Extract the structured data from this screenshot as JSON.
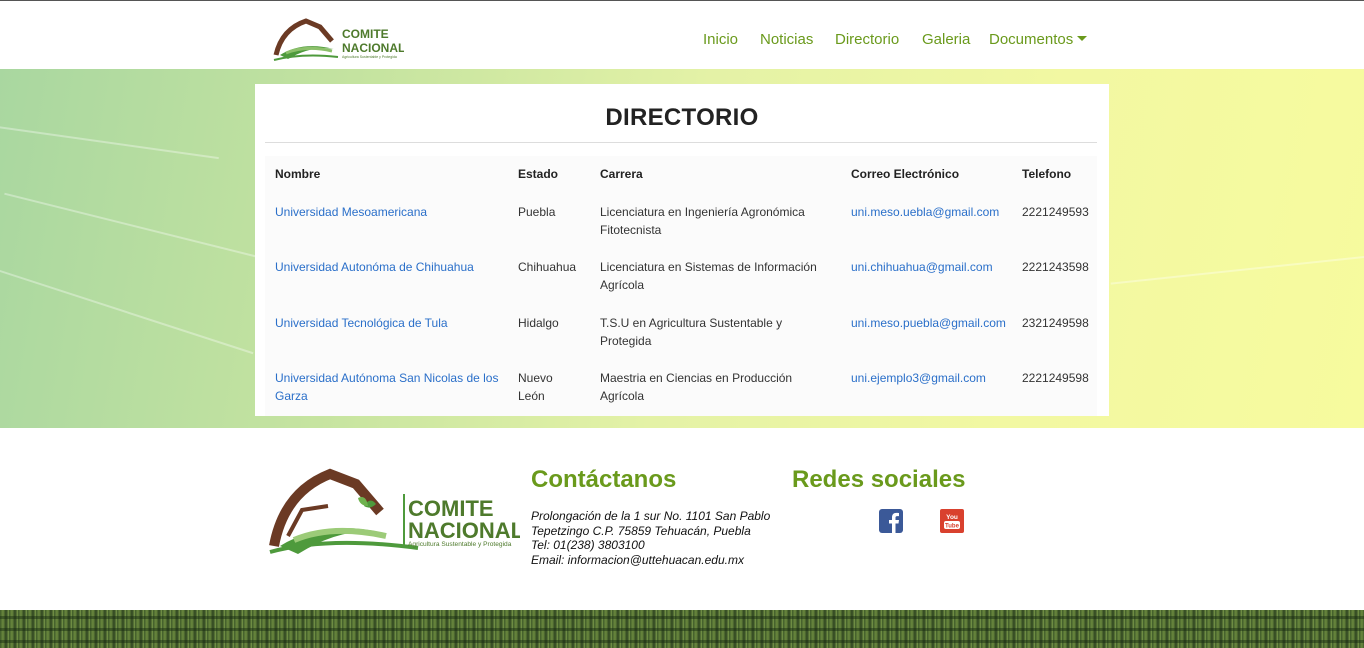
{
  "logo_text": "COMITE NACIONAL",
  "logo_tagline": "Agricultura Sustentable y Protegida",
  "nav": {
    "items": [
      "Inicio",
      "Noticias",
      "Directorio",
      "Galeria",
      "Documentos"
    ]
  },
  "directory": {
    "title": "DIRECTORIO",
    "columns": [
      "Nombre",
      "Estado",
      "Carrera",
      "Correo Electrónico",
      "Telefono"
    ],
    "rows": [
      {
        "nombre": [
          "Universidad Mesoamericana",
          ""
        ],
        "estado": [
          "Puebla",
          ""
        ],
        "carrera": [
          "Licenciatura en Ingeniería Agronómica",
          "Fitotecnista"
        ],
        "correo": "uni.meso.uebla@gmail.com",
        "telefono": "2221249593"
      },
      {
        "nombre": [
          "Universidad Autonóma de Chihuahua",
          ""
        ],
        "estado": [
          "Chihuahua",
          ""
        ],
        "carrera": [
          "Licenciatura en Sistemas de Información",
          "Agrícola"
        ],
        "correo": "uni.chihuahua@gmail.com",
        "telefono": "2221243598"
      },
      {
        "nombre": [
          "Universidad Tecnológica de Tula",
          ""
        ],
        "estado": [
          "Hidalgo",
          ""
        ],
        "carrera": [
          "T.S.U en Agricultura Sustentable y",
          "Protegida"
        ],
        "correo": "uni.meso.puebla@gmail.com",
        "telefono": "2321249598"
      },
      {
        "nombre": [
          "Universidad Autónoma San Nicolas de los",
          "Garza"
        ],
        "estado": [
          "Nuevo",
          "León"
        ],
        "carrera": [
          "Maestria en Ciencias en Producción",
          "Agrícola"
        ],
        "correo": "uni.ejemplo3@gmail.com",
        "telefono": "2221249598"
      }
    ]
  },
  "footer": {
    "contact_heading": "Contáctanos",
    "address_lines": [
      "Prolongación de la 1 sur No. 1101 San Pablo",
      "Tepetzingo C.P. 75859 Tehuacán, Puebla",
      "Tel: 01(238) 3803100",
      "Email: informacion@uttehuacan.edu.mx"
    ],
    "social_heading": "Redes sociales",
    "social_icons": [
      "facebook-icon",
      "youtube-icon"
    ],
    "youtube_badge": "You Tube"
  },
  "colors": {
    "brand_green": "#6a9a1c",
    "link_blue": "#2a6fc9",
    "logo_brown": "#6b3a24",
    "logo_green": "#4e9a3c",
    "facebook_blue": "#3b5998",
    "youtube_red": "#d9412e"
  }
}
